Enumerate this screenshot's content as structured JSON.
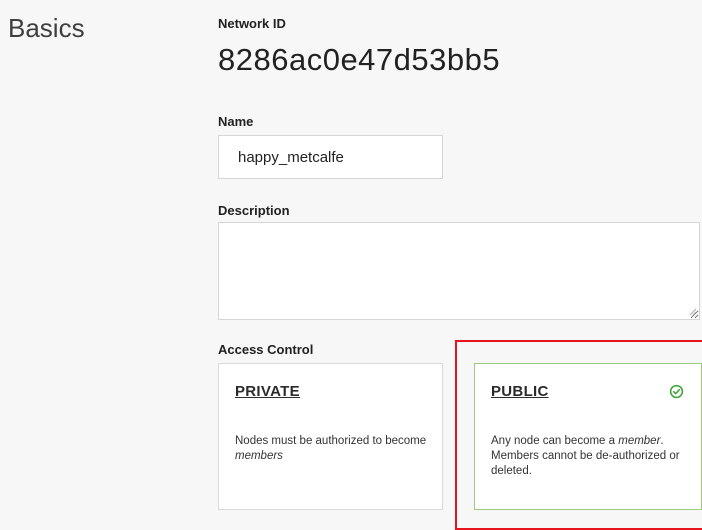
{
  "section": {
    "title": "Basics"
  },
  "network": {
    "id_label": "Network ID",
    "id_value": "8286ac0e47d53bb5"
  },
  "name": {
    "label": "Name",
    "value": "happy_metcalfe"
  },
  "description": {
    "label": "Description",
    "value": ""
  },
  "access_control": {
    "label": "Access Control",
    "selected": "public",
    "options": [
      {
        "title": "PRIVATE",
        "desc_before": "Nodes must be authorized to become ",
        "desc_em": "members",
        "desc_after": ""
      },
      {
        "title": "PUBLIC",
        "desc_before": "Any node can become a ",
        "desc_em": "member",
        "desc_after": ". Members cannot be de-authorized or deleted."
      }
    ]
  },
  "colors": {
    "selected_border": "#9ccc7a",
    "check_icon": "#3aa335",
    "highlight": "#e8141b"
  },
  "icons": {
    "selected_check": "check-circle-icon",
    "textarea_grip": "resize-grip-icon"
  }
}
